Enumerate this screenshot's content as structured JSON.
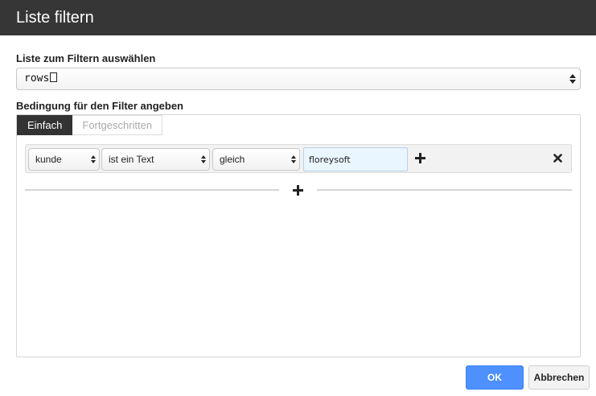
{
  "dialog": {
    "title": "Liste filtern"
  },
  "list_section": {
    "label": "Liste zum Filtern auswählen",
    "selected_value": "rows"
  },
  "condition_section": {
    "label": "Bedingung für den Filter angeben",
    "tabs": [
      {
        "label": "Einfach",
        "active": true
      },
      {
        "label": "Fortgeschritten",
        "active": false
      }
    ],
    "row": {
      "field": "kunde",
      "type": "ist ein Text",
      "operator": "gleich",
      "value": "floreysoft"
    }
  },
  "buttons": {
    "ok": "OK",
    "cancel": "Abbrechen"
  },
  "colors": {
    "titlebar": "#363636",
    "primary": "#4d90fe",
    "input_bg": "#eaf6ff"
  },
  "icons": {
    "add_row": "plus-icon",
    "remove_row": "close-icon",
    "add_group": "plus-icon"
  }
}
